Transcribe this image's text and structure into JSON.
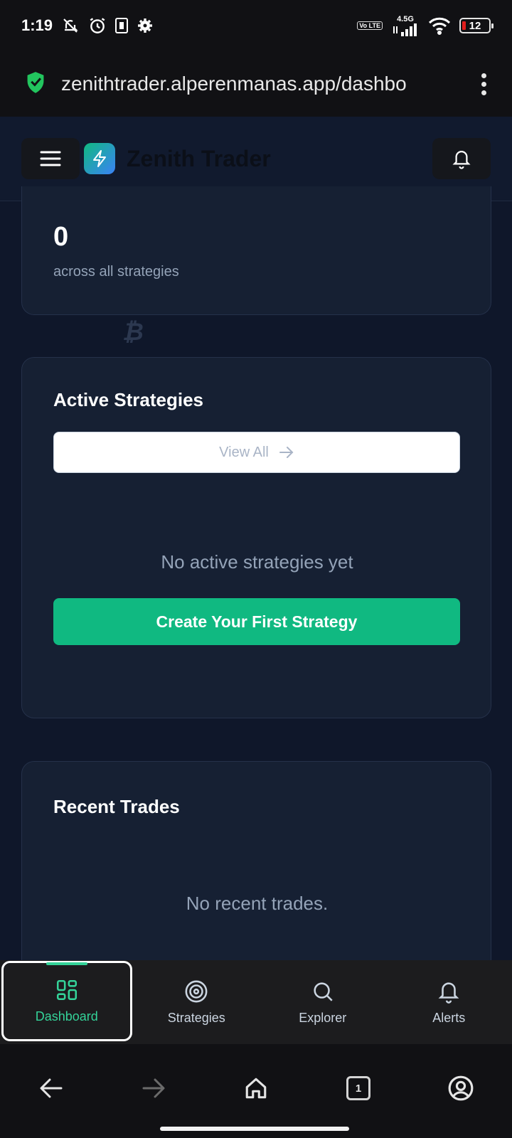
{
  "status_bar": {
    "time": "1:19",
    "network": "4.5G",
    "volte": "Vo LTE",
    "battery": "12"
  },
  "browser": {
    "url": "zenithtrader.alperenmanas.app/dashbo",
    "tab_count": "1"
  },
  "header": {
    "brand": "Zenith Trader"
  },
  "stat": {
    "value": "0",
    "caption": "across all strategies"
  },
  "active_strategies": {
    "title": "Active Strategies",
    "view_all_label": "View All",
    "empty_text": "No active strategies yet",
    "create_label": "Create Your First Strategy"
  },
  "recent_trades": {
    "title": "Recent Trades",
    "empty_text": "No recent trades."
  },
  "tabs": [
    {
      "label": "Dashboard",
      "icon": "dashboard-icon",
      "active": true
    },
    {
      "label": "Strategies",
      "icon": "target-icon",
      "active": false
    },
    {
      "label": "Explorer",
      "icon": "search-icon",
      "active": false
    },
    {
      "label": "Alerts",
      "icon": "bell-icon",
      "active": false
    }
  ],
  "colors": {
    "accent": "#10b981",
    "background": "#0f172a",
    "card": "#162033"
  }
}
